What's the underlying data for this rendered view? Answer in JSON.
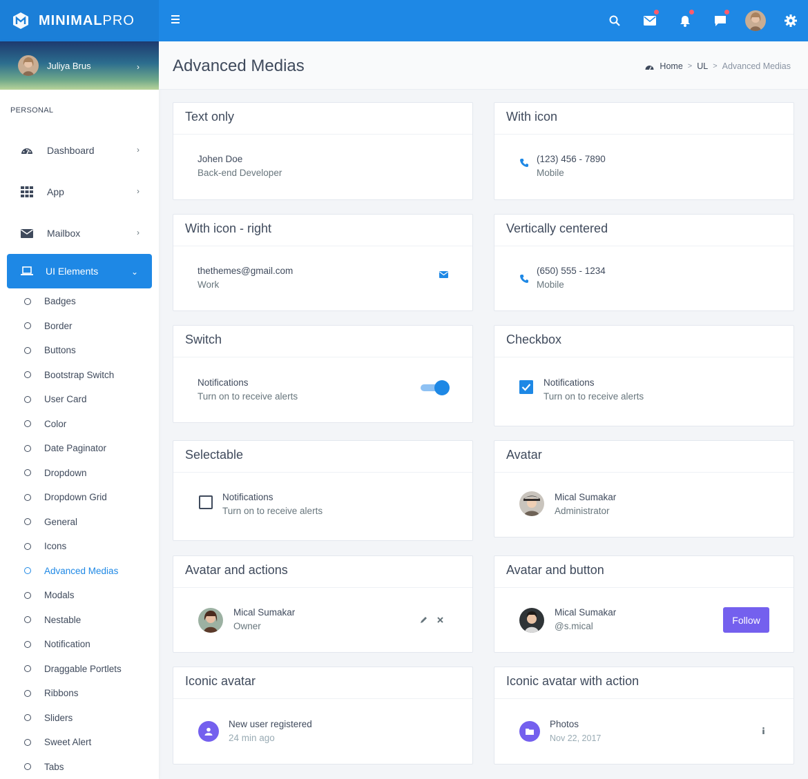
{
  "brand": {
    "name_bold": "MINIMAL",
    "name_light": "PRO"
  },
  "user": {
    "name": "Juliya Brus"
  },
  "sidebar": {
    "section_label": "PERSONAL",
    "items": [
      {
        "label": "Dashboard",
        "icon": "dashboard-icon"
      },
      {
        "label": "App",
        "icon": "grid-icon"
      },
      {
        "label": "Mailbox",
        "icon": "envelope-icon"
      }
    ],
    "active": {
      "label": "UI Elements",
      "icon": "laptop-icon"
    },
    "sub_items": [
      "Badges",
      "Border",
      "Buttons",
      "Bootstrap Switch",
      "User Card",
      "Color",
      "Date Paginator",
      "Dropdown",
      "Dropdown Grid",
      "General",
      "Icons",
      "Advanced Medias",
      "Modals",
      "Nestable",
      "Notification",
      "Draggable Portlets",
      "Ribbons",
      "Sliders",
      "Sweet Alert",
      "Tabs"
    ],
    "current_sub": "Advanced Medias"
  },
  "header": {
    "title": "Advanced Medias",
    "breadcrumb": {
      "home": "Home",
      "ui": "UL",
      "current": "Advanced Medias"
    }
  },
  "colors": {
    "primary": "#1e88e5",
    "purple": "#7460ee",
    "notify": "#ff5c6c"
  },
  "cards": {
    "text_only": {
      "title": "Text only",
      "name": "Johen Doe",
      "sub": "Back-end Developer"
    },
    "with_icon": {
      "title": "With icon",
      "phone": "(123) 456 - 7890",
      "sub": "Mobile"
    },
    "icon_right": {
      "title": "With icon - right",
      "email": "thethemes@gmail.com",
      "sub": "Work"
    },
    "vcenter": {
      "title": "Vertically centered",
      "phone": "(650) 555 - 1234",
      "sub": "Mobile"
    },
    "switch": {
      "title": "Switch",
      "label": "Notifications",
      "sub": "Turn on to receive alerts",
      "on": true
    },
    "checkbox": {
      "title": "Checkbox",
      "label": "Notifications",
      "sub": "Turn on to receive alerts",
      "checked": true
    },
    "selectable": {
      "title": "Selectable",
      "label": "Notifications",
      "sub": "Turn on to receive alerts",
      "checked": false
    },
    "avatar": {
      "title": "Avatar",
      "name": "Mical Sumakar",
      "sub": "Administrator"
    },
    "avatar_actions": {
      "title": "Avatar and actions",
      "name": "Mical Sumakar",
      "sub": "Owner"
    },
    "avatar_button": {
      "title": "Avatar and button",
      "name": "Mical Sumakar",
      "sub": "@s.mical",
      "button": "Follow"
    },
    "iconic": {
      "title": "Iconic avatar",
      "label": "New user registered",
      "sub": "24 min ago"
    },
    "iconic_action": {
      "title": "Iconic avatar with action",
      "label": "Photos",
      "sub": "Nov 22, 2017"
    }
  }
}
